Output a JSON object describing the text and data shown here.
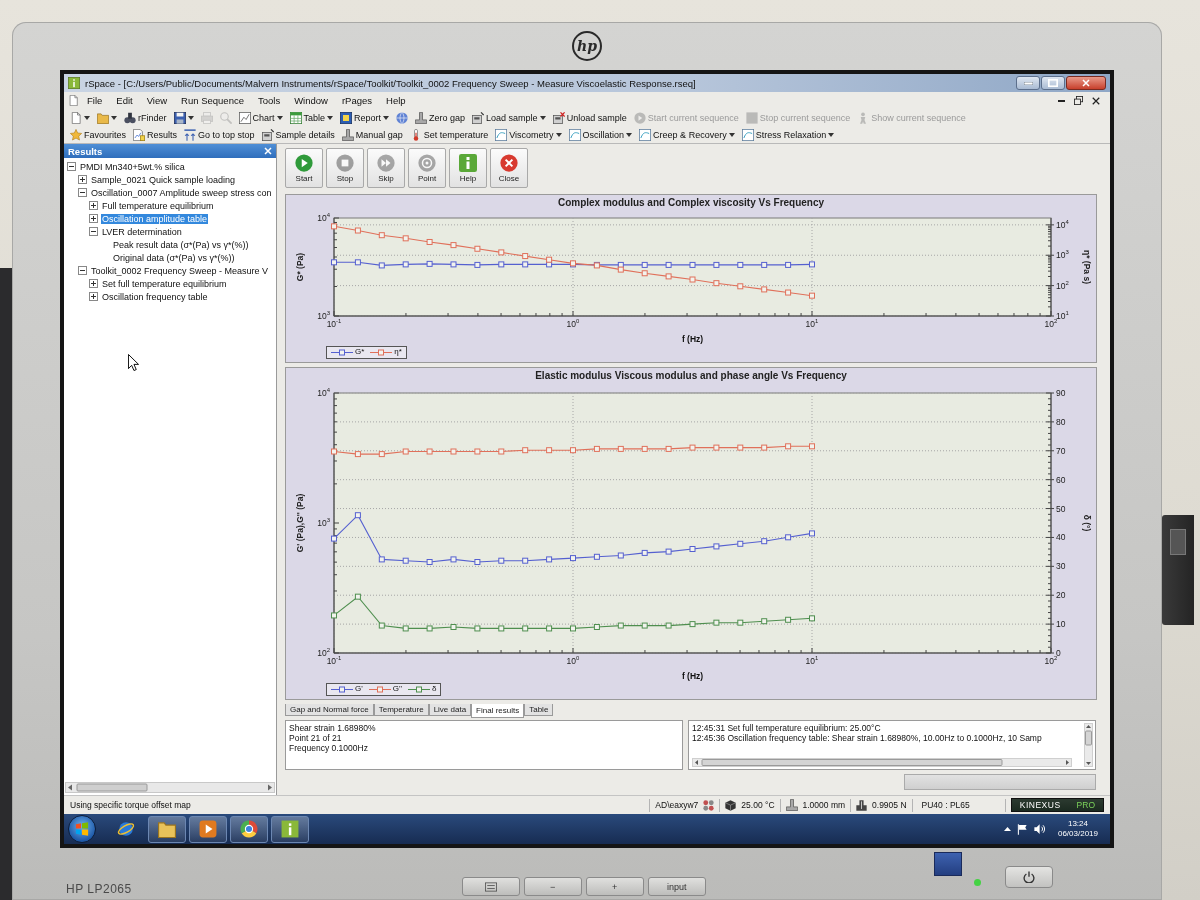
{
  "monitor": {
    "logo": "hp",
    "model": "HP LP2065",
    "buttons": [
      {
        "kind": "icon"
      },
      {
        "kind": "text",
        "label": "−"
      },
      {
        "kind": "text",
        "label": "+"
      },
      {
        "kind": "text",
        "label": "input"
      }
    ],
    "power_led": {
      "on": true
    }
  },
  "window": {
    "title": "rSpace - [C:/Users/Public/Documents/Malvern Instruments/rSpace/Toolkit/Toolkit_0002 Frequency Sweep - Measure Viscoelastic Response.rseq]"
  },
  "menu": [
    "File",
    "Edit",
    "View",
    "Run Sequence",
    "Tools",
    "Window",
    "rPages",
    "Help"
  ],
  "toolbars": [
    [
      {
        "kind": "icon-dropdown",
        "disabled": false
      },
      {
        "kind": "icon-dropdown",
        "disabled": false
      },
      {
        "kind": "button",
        "label": "rFinder",
        "disabled": false
      },
      {
        "kind": "icon-dropdown",
        "disabled": false
      },
      {
        "kind": "icon",
        "disabled": true
      },
      {
        "kind": "icon",
        "disabled": true
      },
      {
        "kind": "dropdown",
        "label": "Chart",
        "disabled": false
      },
      {
        "kind": "dropdown",
        "label": "Table",
        "disabled": false
      },
      {
        "kind": "dropdown",
        "label": "Report",
        "disabled": false
      },
      {
        "kind": "icon",
        "disabled": false
      },
      {
        "kind": "button",
        "label": "Zero gap",
        "disabled": false
      },
      {
        "kind": "dropdown",
        "label": "Load sample",
        "disabled": false
      },
      {
        "kind": "button",
        "label": "Unload sample",
        "disabled": false
      },
      {
        "kind": "button",
        "label": "Start current sequence",
        "disabled": true
      },
      {
        "kind": "button",
        "label": "Stop current sequence",
        "disabled": true
      },
      {
        "kind": "button",
        "label": "Show current sequence",
        "disabled": true
      }
    ],
    [
      {
        "kind": "button",
        "label": "Favourites"
      },
      {
        "kind": "button",
        "label": "Results"
      },
      {
        "kind": "button",
        "label": "Go to top stop"
      },
      {
        "kind": "button",
        "label": "Sample details"
      },
      {
        "kind": "button",
        "label": "Manual gap"
      },
      {
        "kind": "button",
        "label": "Set temperature"
      },
      {
        "kind": "dropdown",
        "label": "Viscometry"
      },
      {
        "kind": "dropdown",
        "label": "Oscillation"
      },
      {
        "kind": "dropdown",
        "label": "Creep & Recovery"
      },
      {
        "kind": "dropdown",
        "label": "Stress Relaxation"
      }
    ]
  ],
  "results_panel": {
    "title": "Results",
    "tree": [
      {
        "label": "PMDI Mn340+5wt.% silica",
        "kind": "group",
        "expanded": true,
        "selected": false,
        "children": [
          {
            "label": "Sample_0021 Quick sample loading",
            "kind": "group",
            "expanded": false,
            "selected": false
          },
          {
            "label": "Oscillation_0007 Amplitude sweep stress con",
            "kind": "group",
            "expanded": true,
            "selected": false,
            "children": [
              {
                "label": "Full temperature equilibrium",
                "kind": "group",
                "expanded": false,
                "selected": false
              },
              {
                "label": "Oscillation amplitude table",
                "kind": "group",
                "expanded": false,
                "selected": true
              },
              {
                "label": "LVER determination",
                "kind": "group",
                "expanded": true,
                "selected": false,
                "children": [
                  {
                    "label": "Peak result data (σ*(Pa) vs γ*(%))",
                    "kind": "leaf",
                    "selected": false
                  },
                  {
                    "label": "Original data (σ*(Pa) vs γ*(%))",
                    "kind": "leaf",
                    "selected": false
                  }
                ]
              }
            ]
          },
          {
            "label": "Toolkit_0002 Frequency Sweep - Measure V",
            "kind": "group",
            "expanded": true,
            "selected": false,
            "children": [
              {
                "label": "Set full temperature equilibrium",
                "kind": "group",
                "expanded": false,
                "selected": false
              },
              {
                "label": "Oscillation frequency table",
                "kind": "group",
                "expanded": false,
                "selected": false
              }
            ]
          }
        ]
      }
    ]
  },
  "commands": [
    {
      "label": "Start",
      "disabled": false
    },
    {
      "label": "Stop",
      "disabled": true
    },
    {
      "label": "Skip",
      "disabled": true
    },
    {
      "label": "Point",
      "disabled": true
    },
    {
      "label": "Help",
      "disabled": false
    },
    {
      "label": "Close",
      "disabled": false
    }
  ],
  "charts": [
    {
      "title": "Complex modulus and Complex viscosity Vs Frequency",
      "x_axis": {
        "label": "f (Hz)",
        "tick_labels": [
          "10$^{-1}$",
          "10$^{0}$",
          "10$^{1}$",
          "10$^{2}$"
        ]
      },
      "y_axis": {
        "label": "G* (Pa)",
        "tick_labels": [
          "10$^{4}$",
          "10$^{3}$"
        ]
      },
      "y2_axis": {
        "label": "η* (Pa s)",
        "tick_labels": [
          "10$^{4}$",
          "10$^{3}$",
          "10$^{2}$",
          "10$^{1}$"
        ]
      },
      "legend": [
        {
          "name": "G*",
          "color": "#5560d0"
        },
        {
          "name": "η*",
          "color": "#e0705a"
        }
      ]
    },
    {
      "title": "Elastic modulus Viscous modulus and phase angle Vs Frequency",
      "x_axis": {
        "label": "f (Hz)",
        "tick_labels": [
          "10$^{-1}$",
          "10$^{0}$",
          "10$^{1}$",
          "10$^{2}$"
        ]
      },
      "y_axis": {
        "label": "G' (Pa),G'' (Pa)",
        "tick_labels": [
          "10$^{4}$",
          "10$^{3}$",
          "10$^{2}$"
        ]
      },
      "y2_axis": {
        "label": "δ (°)",
        "tick_labels": [
          "90",
          "80",
          "70",
          "60",
          "50",
          "40",
          "30",
          "20",
          "10",
          "0"
        ]
      },
      "legend": [
        {
          "name": "G'",
          "color": "#5560d0"
        },
        {
          "name": "G''",
          "color": "#e0705a"
        },
        {
          "name": "δ",
          "color": "#4f8f4f"
        }
      ]
    }
  ],
  "bottom_tabs": [
    {
      "label": "Gap and Normal force",
      "selected": false
    },
    {
      "label": "Temperature",
      "selected": false
    },
    {
      "label": "Live data",
      "selected": false
    },
    {
      "label": "Final results",
      "selected": true
    },
    {
      "label": "Table",
      "selected": false
    }
  ],
  "details": [
    "Shear strain 1.68980%",
    "Point 21 of 21",
    "Frequency 0.1000Hz"
  ],
  "log": [
    "12:45:31 Set full temperature equilibrium: 25.00°C",
    "12:45:36 Oscillation frequency table: Shear strain 1.68980%, 10.00Hz to 0.1000Hz, 10 Samp"
  ],
  "progress": {
    "level": 0
  },
  "status_bar": {
    "message": "Using specific torque offset map",
    "user": "AD\\eaxyw7",
    "temperature": "25.00 °C",
    "gap": "1.0000 mm",
    "normal_force": "0.9905 N",
    "geometry": "PU40 : PL65",
    "brand": "KINEXUS",
    "edition": "PRO"
  },
  "taskbar": {
    "apps": [
      {
        "open": false
      },
      {
        "open": true
      },
      {
        "open": true
      },
      {
        "open": true
      },
      {
        "open": true
      }
    ],
    "time": "13:24",
    "date": "06/03/2019"
  }
}
